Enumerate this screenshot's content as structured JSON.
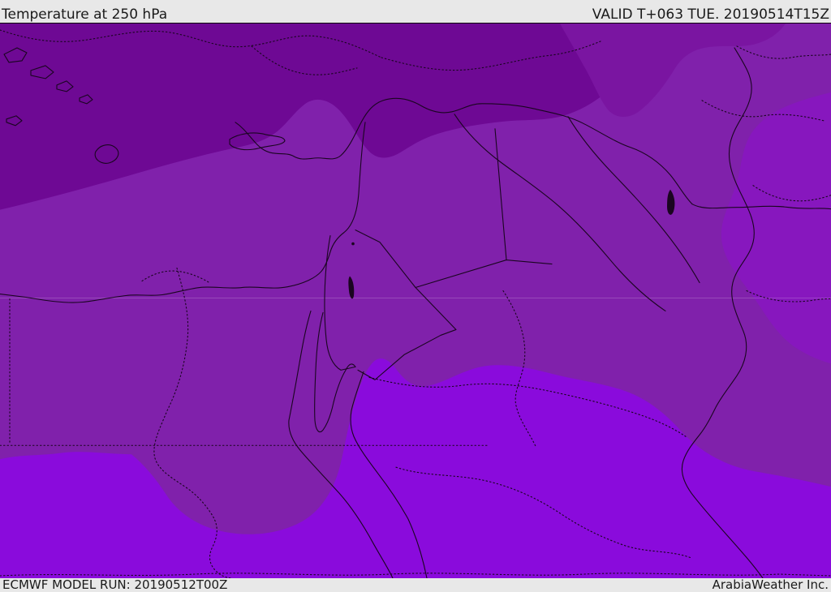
{
  "header": {
    "title": "Temperature at 250 hPa",
    "validity": "VALID T+063 TUE. 20190514T15Z",
    "bg": "#e8e8e8"
  },
  "footer": {
    "model_run": "ECMWF MODEL RUN: 20190512T00Z",
    "provider": "ArabiaWeather Inc.",
    "bg": "#e8e8e8"
  },
  "map": {
    "parameter": "Temperature at 250 hPa",
    "colors": {
      "band_dark": "#6e0994",
      "band_medium_dark": "#7a15a1",
      "band_medium": "#8021ab",
      "band_bright_east": "#8717be",
      "band_bright": "#8a0bdc",
      "line": "#1a0520",
      "faint_contour": "rgba(255,255,255,0.18)"
    }
  }
}
